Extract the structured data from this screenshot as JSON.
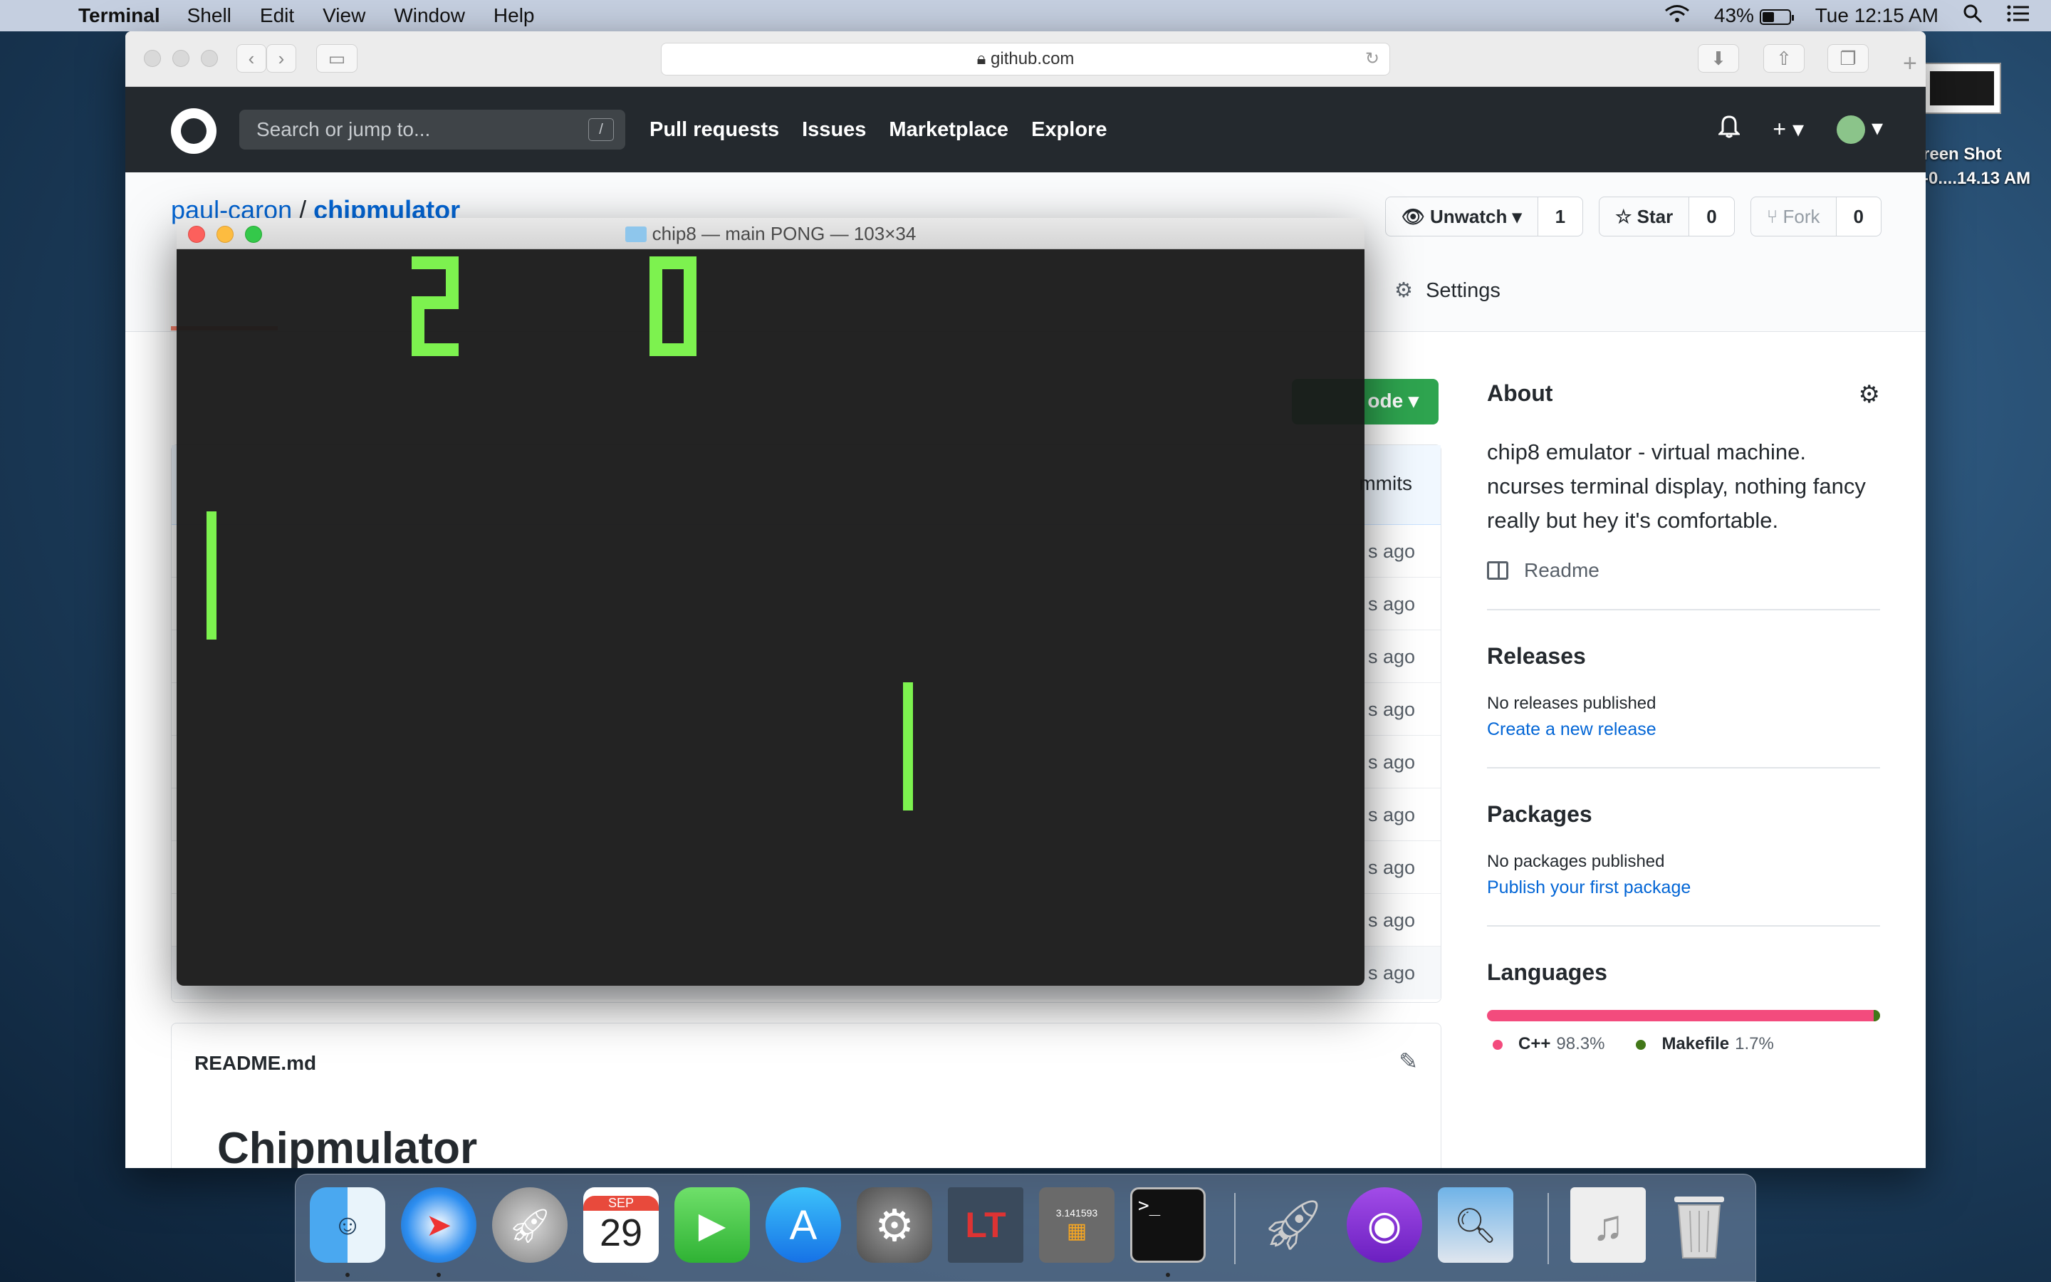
{
  "menubar": {
    "app_name": "Terminal",
    "menus": [
      "Shell",
      "Edit",
      "View",
      "Window",
      "Help"
    ],
    "battery": "43%",
    "clock": "Tue 12:15 AM"
  },
  "desktop": {
    "file_label_line1": "reen Shot",
    "file_label_line2": "-0....14.13 AM"
  },
  "safari": {
    "address": "github.com"
  },
  "github": {
    "search_placeholder": "Search or jump to...",
    "search_shortcut": "/",
    "nav": [
      "Pull requests",
      "Issues",
      "Marketplace",
      "Explore"
    ],
    "repo_owner": "paul-caron",
    "repo_sep": "/",
    "repo_name": "chipmulator",
    "watch_label": "Unwatch",
    "watch_count": "1",
    "star_label": "Star",
    "star_count": "0",
    "fork_label": "Fork",
    "fork_count": "0",
    "settings_tab": "Settings",
    "code_button": "ode",
    "commits_label": "mmits",
    "file_ages": [
      "s ago",
      "s ago",
      "s ago",
      "s ago",
      "s ago",
      "s ago",
      "s ago",
      "s ago",
      "s ago"
    ],
    "readme_file": "README.md",
    "readme_heading": "Chipmulator"
  },
  "sidebar": {
    "about_title": "About",
    "about_text": "chip8 emulator - virtual machine. ncurses terminal display, nothing fancy really but hey it's comfortable.",
    "readme_link": "Readme",
    "releases_title": "Releases",
    "releases_none": "No releases published",
    "releases_link": "Create a new release",
    "packages_title": "Packages",
    "packages_none": "No packages published",
    "packages_link": "Publish your first package",
    "languages_title": "Languages",
    "languages": [
      {
        "name": "C++",
        "pct": "98.3%",
        "color": "#f34b7d",
        "share": 0.983
      },
      {
        "name": "Makefile",
        "pct": "1.7%",
        "color": "#427819",
        "share": 0.017
      }
    ]
  },
  "terminal": {
    "title": "chip8 — main PONG — 103×34",
    "game": {
      "score_left": "2",
      "score_right": "0",
      "pixel_color": "#7df24f"
    }
  },
  "dock": {
    "calendar_month": "SEP",
    "calendar_day": "29",
    "terminal_prompt": ">_",
    "calculator_display": "3.141593",
    "items": [
      "finder-icon",
      "safari-icon",
      "launchpad-icon",
      "calendar-icon",
      "facetime-icon",
      "app-store-icon",
      "system-preferences-icon",
      "ltspice-icon",
      "calculator-icon",
      "terminal-icon",
      "rocket-icon",
      "podcasts-icon",
      "preview-icon",
      "music-file-icon",
      "trash-icon"
    ]
  }
}
